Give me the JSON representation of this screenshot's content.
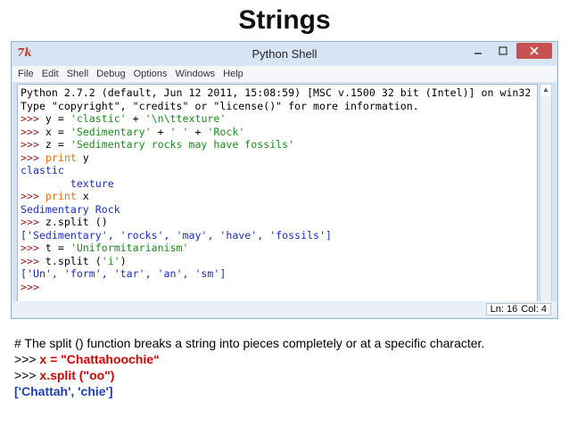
{
  "slide": {
    "title": "Strings"
  },
  "window": {
    "title": "Python Shell",
    "logo": "7k"
  },
  "menu": [
    "File",
    "Edit",
    "Shell",
    "Debug",
    "Options",
    "Windows",
    "Help"
  ],
  "shell_lines": [
    [
      {
        "t": "Python 2.7.2 (default, Jun 12 2011, 15:08:59) [MSC v.1500 32 bit (Intel)] on win32",
        "c": "out"
      }
    ],
    [
      {
        "t": "Type \"copyright\", \"credits\" or \"license()\" for more information.",
        "c": "out"
      }
    ],
    [
      {
        "t": ">>> ",
        "c": "prompt"
      },
      {
        "t": "y = ",
        "c": "code"
      },
      {
        "t": "'clastic'",
        "c": "str"
      },
      {
        "t": " + ",
        "c": "code"
      },
      {
        "t": "'\\n\\ttexture'",
        "c": "str"
      }
    ],
    [
      {
        "t": ">>> ",
        "c": "prompt"
      },
      {
        "t": "x = ",
        "c": "code"
      },
      {
        "t": "'Sedimentary'",
        "c": "str"
      },
      {
        "t": " + ",
        "c": "code"
      },
      {
        "t": "' '",
        "c": "str"
      },
      {
        "t": " + ",
        "c": "code"
      },
      {
        "t": "'Rock'",
        "c": "str"
      }
    ],
    [
      {
        "t": ">>> ",
        "c": "prompt"
      },
      {
        "t": "z = ",
        "c": "code"
      },
      {
        "t": "'Sedimentary rocks may have fossils'",
        "c": "str"
      }
    ],
    [
      {
        "t": ">>> ",
        "c": "prompt"
      },
      {
        "t": "print",
        "c": "kw"
      },
      {
        "t": " y",
        "c": "code"
      }
    ],
    [
      {
        "t": "clastic",
        "c": "res"
      }
    ],
    [
      {
        "t": "        texture",
        "c": "res"
      }
    ],
    [
      {
        "t": ">>> ",
        "c": "prompt"
      },
      {
        "t": "print",
        "c": "kw"
      },
      {
        "t": " x",
        "c": "code"
      }
    ],
    [
      {
        "t": "Sedimentary Rock",
        "c": "res"
      }
    ],
    [
      {
        "t": ">>> ",
        "c": "prompt"
      },
      {
        "t": "z.split ()",
        "c": "code"
      }
    ],
    [
      {
        "t": "['Sedimentary', 'rocks', 'may', 'have', 'fossils']",
        "c": "res"
      }
    ],
    [
      {
        "t": ">>> ",
        "c": "prompt"
      },
      {
        "t": "t = ",
        "c": "code"
      },
      {
        "t": "'Uniformitarianism'",
        "c": "str"
      }
    ],
    [
      {
        "t": ">>> ",
        "c": "prompt"
      },
      {
        "t": "t.split (",
        "c": "code"
      },
      {
        "t": "'i'",
        "c": "str"
      },
      {
        "t": ")",
        "c": "code"
      }
    ],
    [
      {
        "t": "['Un', 'form', 'tar', 'an', 'sm']",
        "c": "res"
      }
    ],
    [
      {
        "t": ">>> ",
        "c": "prompt"
      }
    ]
  ],
  "status": {
    "ln": "Ln: 16",
    "col": "Col: 4"
  },
  "note": {
    "comment": "# The split () function breaks a string into pieces completely or at a specific character.",
    "prompt1": ">>> ",
    "code1": "x = \"Chattahoochie“",
    "prompt2": ">>> ",
    "code2": "x.split (\"oo\")",
    "result": "['Chattah', 'chie']"
  },
  "colors": {
    "accent_red": "#d10000",
    "result_blue": "#1f3fb3",
    "string_green": "#1e8a1e",
    "keyword_orange": "#d8751e"
  }
}
